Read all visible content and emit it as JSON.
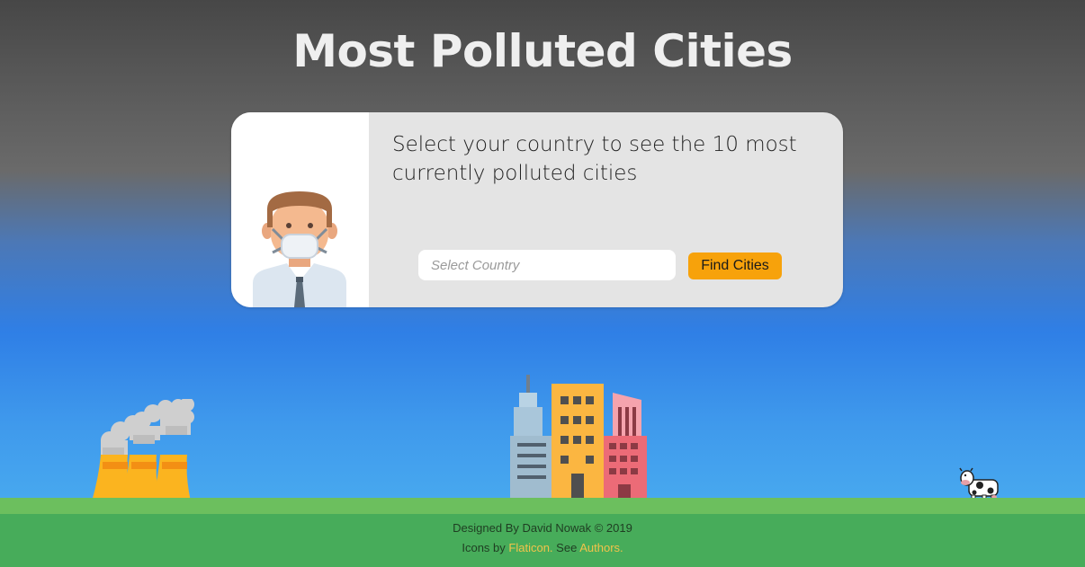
{
  "page": {
    "title": "Most Polluted Cities"
  },
  "card": {
    "description": "Select your country to see the 10 most currently polluted cities",
    "illustration_icon": "man-with-face-mask-icon",
    "search": {
      "placeholder": "Select Country",
      "value": ""
    },
    "button_label": "Find Cities"
  },
  "scene": {
    "factory_icon": "factory-smoke-icon",
    "city_icon": "city-buildings-icon",
    "cow_icon": "cow-icon"
  },
  "footer": {
    "credit": "Designed By David Nowak © 2019",
    "icons_prefix": "Icons by",
    "flaticon_link": "Flaticon.",
    "see_text": "See",
    "authors_link": "Authors."
  },
  "colors": {
    "accent_button": "#f7a20b",
    "link": "#f2c34a",
    "grass": "#47ac5a"
  }
}
